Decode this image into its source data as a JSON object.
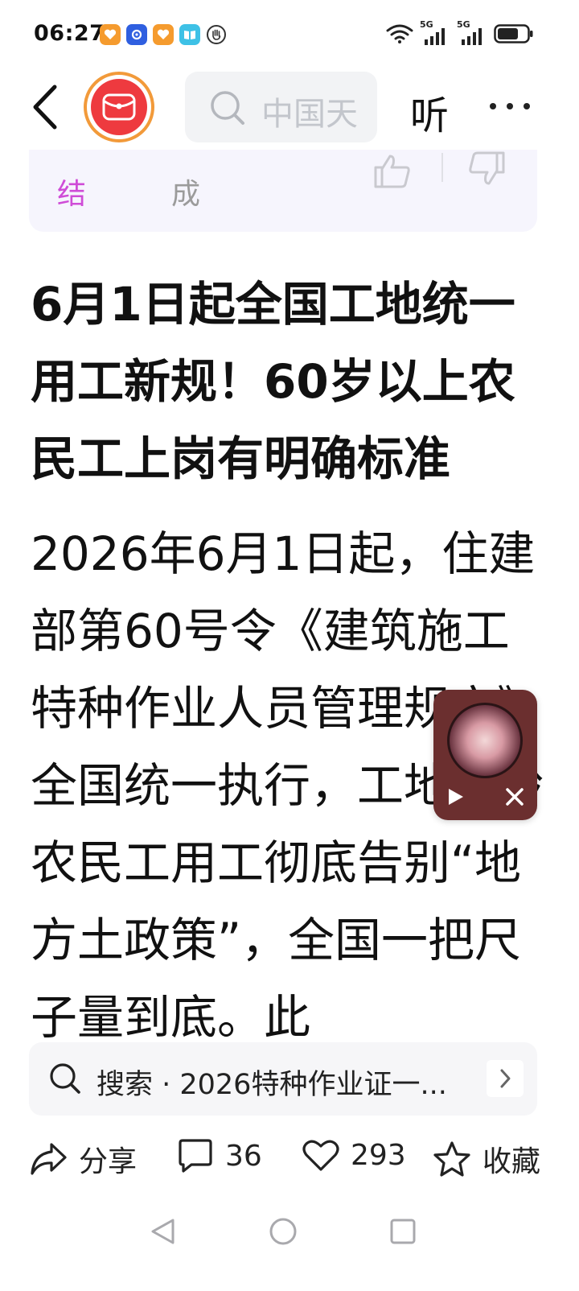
{
  "status_bar": {
    "time": "06:27",
    "network_labels": [
      "5G",
      "5G"
    ]
  },
  "header": {
    "search_placeholder": "中国天",
    "listen_label": "听"
  },
  "summary_card": {
    "label": "结",
    "text": "成"
  },
  "article": {
    "title": "6月1日起全国工地统一用工新规！60岁以上农民工上岗有明确标准",
    "body": "2026年6月1日起，住建部第60号令《建筑施工特种作业人员管理规定》全国统一执行，工地超龄农民工用工彻底告别“地方土政策”，全国一把尺子量到底。此"
  },
  "related_search": {
    "text": "搜索 · 2026特种作业证一..."
  },
  "actions": {
    "share_label": "分享",
    "comment_count": "36",
    "like_count": "293",
    "favorite_label": "收藏"
  },
  "colors": {
    "accent_orange": "#f29a3a",
    "avatar_red": "#ee3a3f",
    "summary_label": "#cf4cd7",
    "player_bg": "#6b2f2f"
  }
}
